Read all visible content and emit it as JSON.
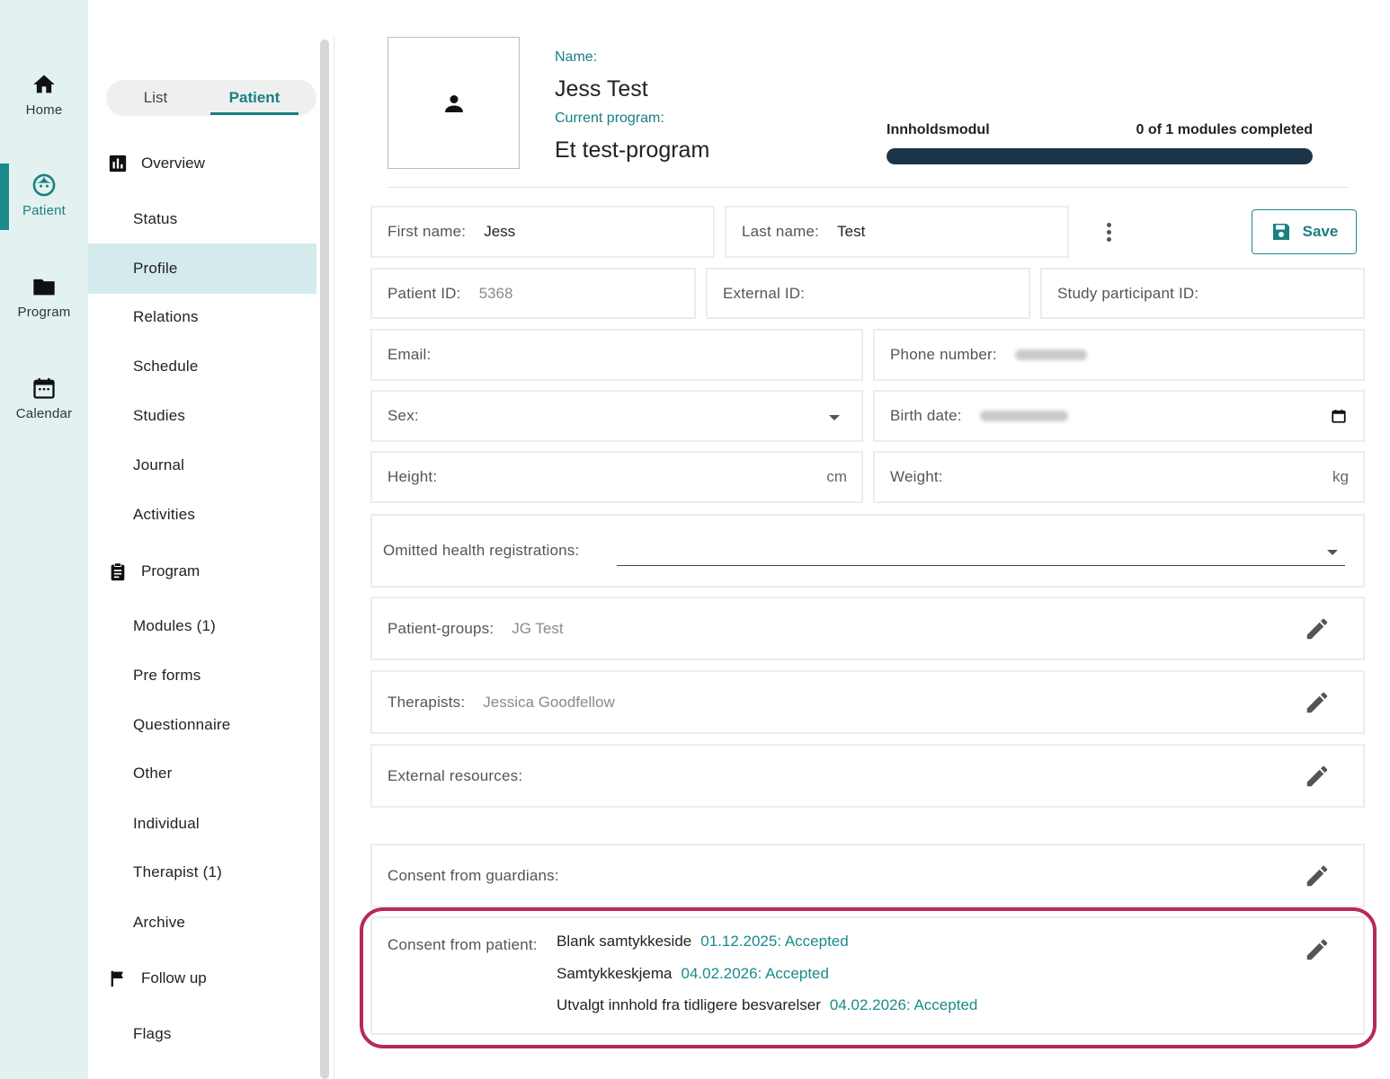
{
  "rail": {
    "items": [
      {
        "label": "Home",
        "icon": "home-icon"
      },
      {
        "label": "Patient",
        "icon": "face-icon"
      },
      {
        "label": "Program",
        "icon": "folder-icon"
      },
      {
        "label": "Calendar",
        "icon": "calendar-icon"
      }
    ],
    "active": "Patient"
  },
  "toggle": {
    "list": "List",
    "patient": "Patient",
    "selected": "Patient"
  },
  "subnav": {
    "sections": [
      {
        "label": "Overview",
        "icon": "chart-icon"
      },
      {
        "label": "Program",
        "icon": "clipboard-icon"
      },
      {
        "label": "Follow up",
        "icon": "flag-icon"
      }
    ],
    "items": [
      "Status",
      "Profile",
      "Relations",
      "Schedule",
      "Studies",
      "Journal",
      "Activities",
      "Modules (1)",
      "Pre forms",
      "Questionnaire",
      "Other",
      "Individual",
      "Therapist (1)",
      "Archive",
      "Flags"
    ],
    "active": "Profile"
  },
  "header": {
    "name_label": "Name:",
    "name": "Jess Test",
    "program_label": "Current program:",
    "program": "Et test-program",
    "module_title": "Innholdsmodul",
    "module_count": "0 of 1 modules completed",
    "progress_fraction": 1.0
  },
  "form": {
    "first_name_label": "First name:",
    "first_name": "Jess",
    "last_name_label": "Last name:",
    "last_name": "Test",
    "save_label": "Save",
    "patient_id_label": "Patient ID:",
    "patient_id": "5368",
    "external_id_label": "External ID:",
    "study_id_label": "Study participant ID:",
    "email_label": "Email:",
    "phone_label": "Phone number:",
    "sex_label": "Sex:",
    "birth_label": "Birth date:",
    "height_label": "Height:",
    "height_unit": "cm",
    "weight_label": "Weight:",
    "weight_unit": "kg",
    "omitted_label": "Omitted health registrations:",
    "groups_label": "Patient-groups:",
    "groups_value": "JG Test",
    "therapists_label": "Therapists:",
    "therapists_value": "Jessica Goodfellow",
    "resources_label": "External resources:",
    "guardians_label": "Consent from guardians:",
    "patient_consent_label": "Consent from patient:",
    "patient_consents": [
      {
        "name": "Blank samtykkeside",
        "status": "01.12.2025: Accepted"
      },
      {
        "name": "Samtykkeskjema",
        "status": "04.02.2026: Accepted"
      },
      {
        "name": "Utvalgt innhold fra tidligere besvarelser",
        "status": "04.02.2026: Accepted"
      }
    ]
  },
  "colors": {
    "accent": "#1a7f82",
    "progress": "#1c3447",
    "highlight": "#b8275f",
    "rail_bg": "#e3f1f1",
    "active_nav_bg": "#d3ebec"
  }
}
